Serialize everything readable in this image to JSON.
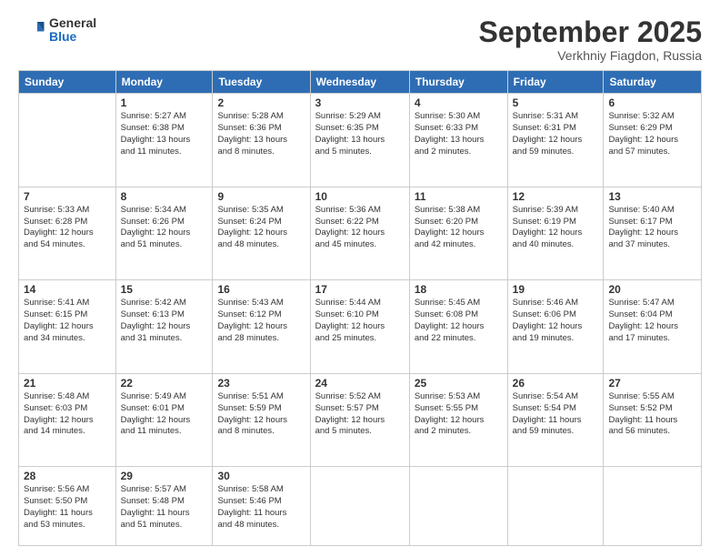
{
  "header": {
    "logo_general": "General",
    "logo_blue": "Blue",
    "month_title": "September 2025",
    "location": "Verkhniy Fiagdon, Russia"
  },
  "weekdays": [
    "Sunday",
    "Monday",
    "Tuesday",
    "Wednesday",
    "Thursday",
    "Friday",
    "Saturday"
  ],
  "weeks": [
    [
      {
        "day": "",
        "info": ""
      },
      {
        "day": "1",
        "info": "Sunrise: 5:27 AM\nSunset: 6:38 PM\nDaylight: 13 hours\nand 11 minutes."
      },
      {
        "day": "2",
        "info": "Sunrise: 5:28 AM\nSunset: 6:36 PM\nDaylight: 13 hours\nand 8 minutes."
      },
      {
        "day": "3",
        "info": "Sunrise: 5:29 AM\nSunset: 6:35 PM\nDaylight: 13 hours\nand 5 minutes."
      },
      {
        "day": "4",
        "info": "Sunrise: 5:30 AM\nSunset: 6:33 PM\nDaylight: 13 hours\nand 2 minutes."
      },
      {
        "day": "5",
        "info": "Sunrise: 5:31 AM\nSunset: 6:31 PM\nDaylight: 12 hours\nand 59 minutes."
      },
      {
        "day": "6",
        "info": "Sunrise: 5:32 AM\nSunset: 6:29 PM\nDaylight: 12 hours\nand 57 minutes."
      }
    ],
    [
      {
        "day": "7",
        "info": "Sunrise: 5:33 AM\nSunset: 6:28 PM\nDaylight: 12 hours\nand 54 minutes."
      },
      {
        "day": "8",
        "info": "Sunrise: 5:34 AM\nSunset: 6:26 PM\nDaylight: 12 hours\nand 51 minutes."
      },
      {
        "day": "9",
        "info": "Sunrise: 5:35 AM\nSunset: 6:24 PM\nDaylight: 12 hours\nand 48 minutes."
      },
      {
        "day": "10",
        "info": "Sunrise: 5:36 AM\nSunset: 6:22 PM\nDaylight: 12 hours\nand 45 minutes."
      },
      {
        "day": "11",
        "info": "Sunrise: 5:38 AM\nSunset: 6:20 PM\nDaylight: 12 hours\nand 42 minutes."
      },
      {
        "day": "12",
        "info": "Sunrise: 5:39 AM\nSunset: 6:19 PM\nDaylight: 12 hours\nand 40 minutes."
      },
      {
        "day": "13",
        "info": "Sunrise: 5:40 AM\nSunset: 6:17 PM\nDaylight: 12 hours\nand 37 minutes."
      }
    ],
    [
      {
        "day": "14",
        "info": "Sunrise: 5:41 AM\nSunset: 6:15 PM\nDaylight: 12 hours\nand 34 minutes."
      },
      {
        "day": "15",
        "info": "Sunrise: 5:42 AM\nSunset: 6:13 PM\nDaylight: 12 hours\nand 31 minutes."
      },
      {
        "day": "16",
        "info": "Sunrise: 5:43 AM\nSunset: 6:12 PM\nDaylight: 12 hours\nand 28 minutes."
      },
      {
        "day": "17",
        "info": "Sunrise: 5:44 AM\nSunset: 6:10 PM\nDaylight: 12 hours\nand 25 minutes."
      },
      {
        "day": "18",
        "info": "Sunrise: 5:45 AM\nSunset: 6:08 PM\nDaylight: 12 hours\nand 22 minutes."
      },
      {
        "day": "19",
        "info": "Sunrise: 5:46 AM\nSunset: 6:06 PM\nDaylight: 12 hours\nand 19 minutes."
      },
      {
        "day": "20",
        "info": "Sunrise: 5:47 AM\nSunset: 6:04 PM\nDaylight: 12 hours\nand 17 minutes."
      }
    ],
    [
      {
        "day": "21",
        "info": "Sunrise: 5:48 AM\nSunset: 6:03 PM\nDaylight: 12 hours\nand 14 minutes."
      },
      {
        "day": "22",
        "info": "Sunrise: 5:49 AM\nSunset: 6:01 PM\nDaylight: 12 hours\nand 11 minutes."
      },
      {
        "day": "23",
        "info": "Sunrise: 5:51 AM\nSunset: 5:59 PM\nDaylight: 12 hours\nand 8 minutes."
      },
      {
        "day": "24",
        "info": "Sunrise: 5:52 AM\nSunset: 5:57 PM\nDaylight: 12 hours\nand 5 minutes."
      },
      {
        "day": "25",
        "info": "Sunrise: 5:53 AM\nSunset: 5:55 PM\nDaylight: 12 hours\nand 2 minutes."
      },
      {
        "day": "26",
        "info": "Sunrise: 5:54 AM\nSunset: 5:54 PM\nDaylight: 11 hours\nand 59 minutes."
      },
      {
        "day": "27",
        "info": "Sunrise: 5:55 AM\nSunset: 5:52 PM\nDaylight: 11 hours\nand 56 minutes."
      }
    ],
    [
      {
        "day": "28",
        "info": "Sunrise: 5:56 AM\nSunset: 5:50 PM\nDaylight: 11 hours\nand 53 minutes."
      },
      {
        "day": "29",
        "info": "Sunrise: 5:57 AM\nSunset: 5:48 PM\nDaylight: 11 hours\nand 51 minutes."
      },
      {
        "day": "30",
        "info": "Sunrise: 5:58 AM\nSunset: 5:46 PM\nDaylight: 11 hours\nand 48 minutes."
      },
      {
        "day": "",
        "info": ""
      },
      {
        "day": "",
        "info": ""
      },
      {
        "day": "",
        "info": ""
      },
      {
        "day": "",
        "info": ""
      }
    ]
  ]
}
